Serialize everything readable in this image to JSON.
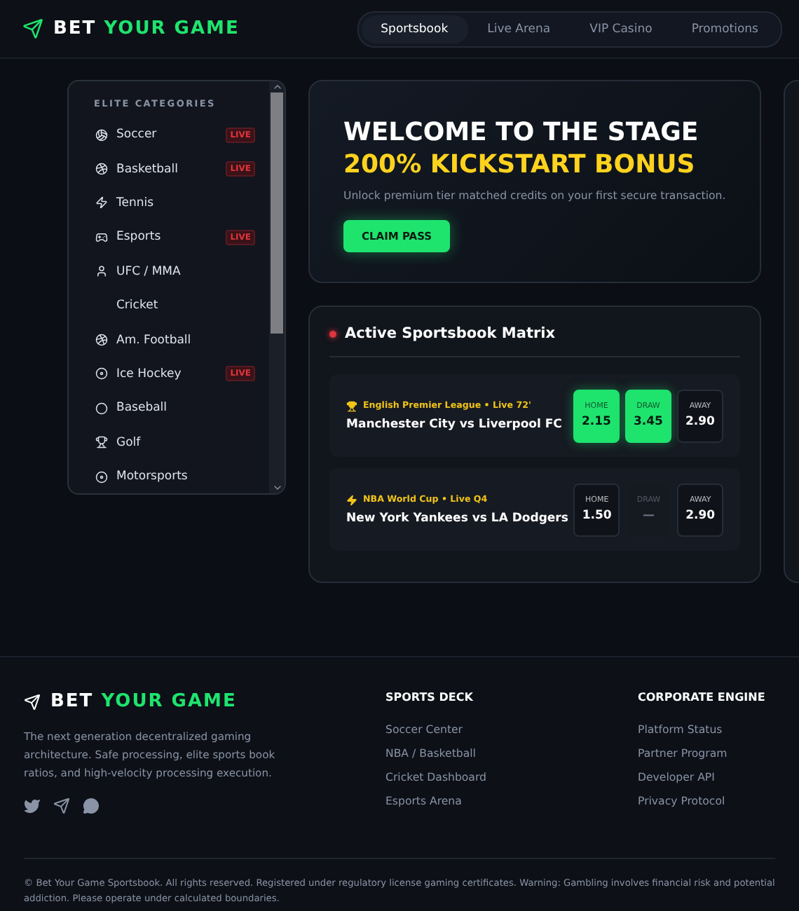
{
  "header": {
    "logo": {
      "first": "BET",
      "second": "YOUR GAME"
    },
    "nav": [
      {
        "label": "Sportsbook",
        "selected": true
      },
      {
        "label": "Live Arena",
        "selected": false
      },
      {
        "label": "VIP Casino",
        "selected": false
      },
      {
        "label": "Promotions",
        "selected": false
      }
    ]
  },
  "sidebar": {
    "title": "ELITE CATEGORIES",
    "items": [
      {
        "label": "Soccer",
        "live": "LIVE"
      },
      {
        "label": "Basketball",
        "live": "LIVE"
      },
      {
        "label": "Tennis"
      },
      {
        "label": "Esports",
        "live": "LIVE"
      },
      {
        "label": "UFC / MMA"
      },
      {
        "label": "Cricket"
      },
      {
        "label": "Am. Football"
      },
      {
        "label": "Ice Hockey",
        "live": "LIVE"
      },
      {
        "label": "Baseball"
      },
      {
        "label": "Golf"
      },
      {
        "label": "Motorsports"
      }
    ]
  },
  "hero": {
    "title": "WELCOME TO THE STAGE",
    "highlight": "200% KICKSTART BONUS",
    "text": "Unlock premium tier matched credits on your first secure transaction.",
    "button": "CLAIM PASS"
  },
  "matrix": {
    "title": "Active Sportsbook Matrix",
    "matches": [
      {
        "league": "English Premier League • Live 72'",
        "teams": "Manchester City vs Liverpool FC",
        "odds": [
          {
            "label": "HOME",
            "value": "2.15",
            "selected": true,
            "disabled": false
          },
          {
            "label": "DRAW",
            "value": "3.45",
            "selected": true,
            "disabled": false
          },
          {
            "label": "AWAY",
            "value": "2.90",
            "selected": false,
            "disabled": false
          }
        ]
      },
      {
        "league": "NBA World Cup • Live Q4",
        "teams": "New York Yankees vs LA Dodgers",
        "odds": [
          {
            "label": "HOME",
            "value": "1.50",
            "selected": false,
            "disabled": false
          },
          {
            "label": "DRAW",
            "value": "—",
            "selected": false,
            "disabled": true
          },
          {
            "label": "AWAY",
            "value": "2.90",
            "selected": false,
            "disabled": false
          }
        ]
      }
    ]
  },
  "footer": {
    "logo": {
      "first": "BET",
      "second": "YOUR GAME"
    },
    "about": "The next generation decentralized gaming architecture. Safe processing, elite sports book ratios, and high-velocity processing execution.",
    "columns": [
      {
        "title": "SPORTS DECK",
        "links": [
          "Soccer Center",
          "NBA / Basketball",
          "Cricket Dashboard",
          "Esports Arena"
        ]
      },
      {
        "title": "CORPORATE ENGINE",
        "links": [
          "Platform Status",
          "Partner Program",
          "Developer API",
          "Privacy Protocol"
        ]
      }
    ],
    "legal": "© Bet Your Game Sportsbook. All rights reserved. Registered under regulatory license gaming certificates. Warning: Gambling involves financial risk and potential addiction. Please operate under calculated boundaries."
  }
}
